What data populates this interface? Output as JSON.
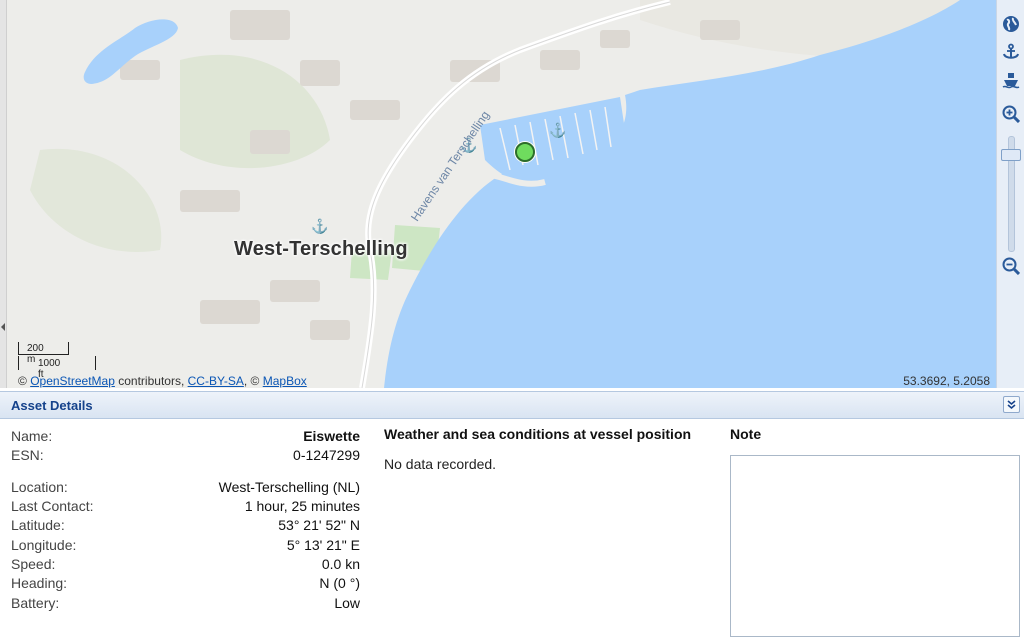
{
  "map": {
    "town_label": "West-Terschelling",
    "harbour_label": "Havens van Terschelling",
    "scale": {
      "metric": "200 m",
      "imperial": "1000 ft"
    },
    "attribution": {
      "prefix": "©",
      "osm_link": "OpenStreetMap",
      "contributors": "contributors,",
      "license_link": "CC-BY-SA",
      "sep": ", ©",
      "mapbox_link": "MapBox"
    },
    "coordinates": "53.3692, 5.2058",
    "anchor_glyph": "⚓"
  },
  "toolbar": {
    "icons": [
      "globe-icon",
      "anchor-icon",
      "ship-icon",
      "zoom-in-icon",
      "zoom-out-icon"
    ],
    "zoom_level_fraction": 0.15
  },
  "panel": {
    "title": "Asset Details"
  },
  "asset": {
    "name": {
      "label": "Name:",
      "value": "Eiswette"
    },
    "esn": {
      "label": "ESN:",
      "value": "0-1247299"
    },
    "location": {
      "label": "Location:",
      "value": "West-Terschelling (NL)"
    },
    "last_contact": {
      "label": "Last Contact:",
      "value": "1 hour, 25 minutes"
    },
    "latitude": {
      "label": "Latitude:",
      "value": "53° 21' 52\" N"
    },
    "longitude": {
      "label": "Longitude:",
      "value": "5° 13' 21\" E"
    },
    "speed": {
      "label": "Speed:",
      "value": "0.0 kn"
    },
    "heading": {
      "label": "Heading:",
      "value": "N (0 °)"
    },
    "battery": {
      "label": "Battery:",
      "value": "Low"
    }
  },
  "weather": {
    "title": "Weather and sea conditions at vessel position",
    "message": "No data recorded."
  },
  "note": {
    "title": "Note",
    "value": ""
  },
  "colors": {
    "water": "#a8d1fb",
    "land": "#ededea",
    "accent": "#15428b",
    "vessel": "#6fdc5e"
  }
}
